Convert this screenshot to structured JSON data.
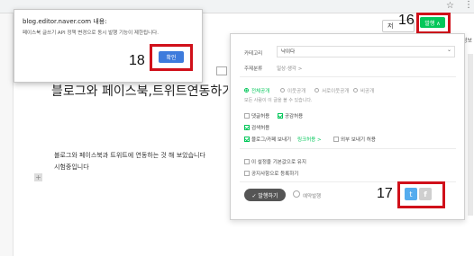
{
  "browser": {
    "star_icon": "star-icon",
    "menu_icon": "kebab-menu-icon"
  },
  "toolbar": {
    "save_label": "저",
    "publish_label": "발행 ∧",
    "right_tab_label": "발행정보",
    "publish_color": "#03c75a"
  },
  "annotations": {
    "label_16": "16",
    "label_17": "17",
    "label_18": "18",
    "highlight_color": "#d0101a"
  },
  "post": {
    "title": "블로그와 페이스북,트위트연동하기",
    "body_line_1": "블로그와 페이스북과 트위트에 연동하는 것 해 보았습니다",
    "body_line_2": "시험중입니다"
  },
  "dialog": {
    "title": "blog.editor.naver.com 내용:",
    "message": "페이스북 글쓰기 API 정책 변경으로 동시 발행 기능이 제한됩니다.",
    "confirm_label": "확인"
  },
  "publish_panel": {
    "category_label": "카테고리",
    "category_value": "낙이다",
    "topic_label": "주제분류",
    "topic_value": "일상·생각 >",
    "visibility_options": [
      {
        "label": "전체공개",
        "selected": true
      },
      {
        "label": "이웃공개",
        "selected": false
      },
      {
        "label": "서로이웃공개",
        "selected": false
      },
      {
        "label": "비공개",
        "selected": false
      }
    ],
    "visibility_note": "모든 사람이 이 글을 볼 수 있습니다.",
    "options": {
      "comments": "댓글허용",
      "likes": "공감허용",
      "search": "검색허용",
      "blog_cafe_share": "블로그/카페 보내기",
      "link_allow": "링크허용 >",
      "external_share": "외부 보내기 허용",
      "set_as_default": "이 설정을 기본값으로 유지",
      "notice": "공지사항으로 등록하기"
    },
    "publish_now_label": "✓ 발행하기",
    "schedule_label": "예약발행",
    "twitter_label": "t",
    "facebook_label": "f"
  }
}
